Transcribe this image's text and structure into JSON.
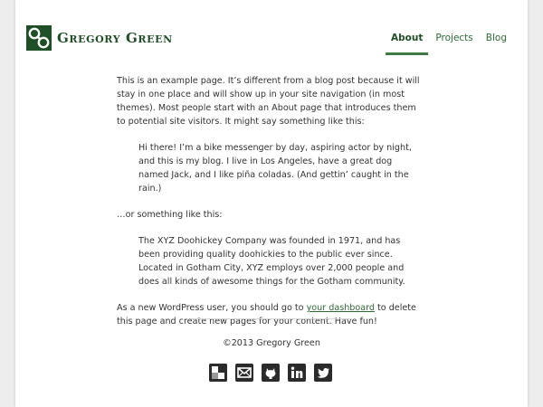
{
  "site": {
    "title": "Gregory Green",
    "brand_color": "#1f4f27",
    "accent_color": "#3f7a46"
  },
  "nav": {
    "items": [
      {
        "label": "About",
        "active": true
      },
      {
        "label": "Projects",
        "active": false
      },
      {
        "label": "Blog",
        "active": false
      }
    ]
  },
  "content": {
    "p1": "This is an example page. It’s different from a blog post because it will stay in one place and will show up in your site navigation (in most themes). Most people start with an About page that introduces them to potential site visitors. It might say something like this:",
    "quote1": "Hi there! I’m a bike messenger by day, aspiring actor by night, and this is my blog. I live in Los Angeles, have a great dog named Jack, and I like piña coladas. (And gettin’ caught in the rain.)",
    "p2": "…or something like this:",
    "quote2": "The XYZ Doohickey Company was founded in 1971, and has been providing quality doohickies to the public ever since. Located in Gotham City, XYZ employs over 2,000 people and does all kinds of awesome things for the Gotham community.",
    "p3_before": "As a new WordPress user, you should go to ",
    "p3_link": "your dashboard",
    "p3_after": " to delete this page and create new pages for your content. Have fun!"
  },
  "footer": {
    "copyright": "©2013 Gregory Green",
    "social_icons": [
      "delicious-icon",
      "email-icon",
      "github-icon",
      "linkedin-icon",
      "twitter-icon"
    ]
  }
}
